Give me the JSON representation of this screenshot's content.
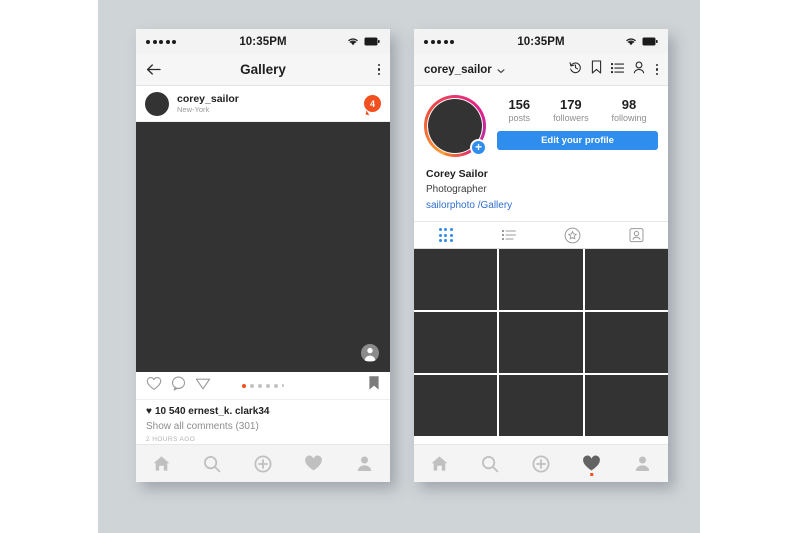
{
  "background": {
    "panel_color": "#cfd4d7",
    "page_color": "#ffffff"
  },
  "colors": {
    "accent_blue": "#2e8ded",
    "accent_orange": "#f2501e",
    "photo_placeholder": "#333333",
    "link_blue": "#2e6fd0",
    "muted_text": "#8e8e8e"
  },
  "phone_left": {
    "status": {
      "time": "10:35PM",
      "signal_dots": 5,
      "wifi_icon": "wifi-icon",
      "battery_icon": "battery-icon"
    },
    "navbar": {
      "back_icon": "arrow-left-icon",
      "title": "Gallery",
      "menu_icon": "more-vertical-icon"
    },
    "post": {
      "avatar": "user-avatar",
      "username": "corey_sailor",
      "location": "New-York",
      "badge_count": "4",
      "photo_tag_icon": "person-tag-icon"
    },
    "actions": {
      "like_icon": "heart-outline-icon",
      "comment_icon": "comment-bubble-icon",
      "share_icon": "paper-plane-icon",
      "bookmark_icon": "bookmark-icon",
      "pager_total": 6,
      "pager_active": 1
    },
    "caption": {
      "likes_heart": "♥",
      "likes_text": "10 540 ernest_k. clark34",
      "comments": "Show all comments (301)",
      "timestamp": "2 HOURS AGO"
    },
    "tabbar": [
      {
        "name": "home-tab",
        "icon": "home-icon",
        "active": false
      },
      {
        "name": "search-tab",
        "icon": "search-icon",
        "active": false
      },
      {
        "name": "add-post-tab",
        "icon": "plus-circle-icon",
        "active": false
      },
      {
        "name": "activity-tab",
        "icon": "heart-icon",
        "active": false
      },
      {
        "name": "profile-tab",
        "icon": "person-icon",
        "active": false
      }
    ]
  },
  "phone_right": {
    "status": {
      "time": "10:35PM",
      "signal_dots": 5,
      "wifi_icon": "wifi-icon",
      "battery_icon": "battery-icon"
    },
    "navbar": {
      "username": "corey_sailor",
      "chevron_icon": "chevron-down-icon",
      "icons": [
        {
          "name": "history-icon"
        },
        {
          "name": "bookmark-icon"
        },
        {
          "name": "list-icon"
        },
        {
          "name": "add-person-icon"
        },
        {
          "name": "more-vertical-icon"
        }
      ]
    },
    "profile": {
      "avatar": "profile-avatar",
      "avatar_add_badge": "+",
      "stats": [
        {
          "value": "156",
          "label": "posts"
        },
        {
          "value": "179",
          "label": "followers"
        },
        {
          "value": "98",
          "label": "following"
        }
      ],
      "edit_button": "Edit your profile",
      "full_name": "Corey Sailor",
      "occupation": "Photographer",
      "link": "sailorphoto /Gallery"
    },
    "profile_tabs": [
      {
        "name": "grid-tab",
        "icon": "grid-icon",
        "active": true
      },
      {
        "name": "list-tab",
        "icon": "list-icon",
        "active": false
      },
      {
        "name": "saved-tab",
        "icon": "star-circle-icon",
        "active": false
      },
      {
        "name": "tagged-tab",
        "icon": "tagged-person-icon",
        "active": false
      }
    ],
    "grid_cells": 9,
    "tabbar": [
      {
        "name": "home-tab",
        "icon": "home-icon",
        "active": false
      },
      {
        "name": "search-tab",
        "icon": "search-icon",
        "active": false
      },
      {
        "name": "add-post-tab",
        "icon": "plus-circle-icon",
        "active": false
      },
      {
        "name": "activity-tab",
        "icon": "heart-icon",
        "active": true
      },
      {
        "name": "profile-tab",
        "icon": "person-icon",
        "active": false
      }
    ]
  }
}
